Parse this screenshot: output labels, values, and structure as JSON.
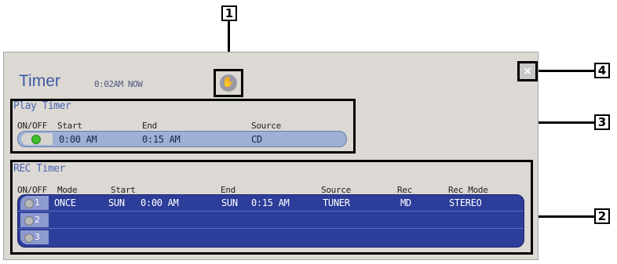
{
  "callouts": {
    "c1": "1",
    "c2": "2",
    "c3": "3",
    "c4": "4"
  },
  "window": {
    "title": "Timer",
    "clock": "0:02AM NOW",
    "close_glyph": "×",
    "hand_glyph": "✋"
  },
  "play_timer": {
    "label": "Play Timer",
    "headers": {
      "onoff": "ON/OFF",
      "start": "Start",
      "end": "End",
      "source": "Source"
    },
    "row": {
      "state": "on",
      "start": "0:00 AM",
      "end": "0:15 AM",
      "source": "CD"
    }
  },
  "rec_timer": {
    "label": "REC Timer",
    "headers": {
      "onoff": "ON/OFF",
      "mode": "Mode",
      "start": "Start",
      "end": "End",
      "source": "Source",
      "rec": "Rec",
      "rec_mode": "Rec Mode"
    },
    "rows": [
      {
        "num": "1",
        "mode": "ONCE",
        "start_day": "SUN",
        "start_time": "0:00 AM",
        "end_day": "SUN",
        "end_time": "0:15 AM",
        "source": "TUNER",
        "rec": "MD",
        "rec_mode": "STEREO"
      },
      {
        "num": "2",
        "mode": "",
        "start_day": "",
        "start_time": "",
        "end_day": "",
        "end_time": "",
        "source": "",
        "rec": "",
        "rec_mode": ""
      },
      {
        "num": "3",
        "mode": "",
        "start_day": "",
        "start_time": "",
        "end_day": "",
        "end_time": "",
        "source": "",
        "rec": "",
        "rec_mode": ""
      }
    ]
  },
  "colors": {
    "accent": "#3d5aa3",
    "led_on": "#3fbf2a",
    "led_off": "#b8b8b8",
    "rec_bg": "#2d3d9a"
  }
}
